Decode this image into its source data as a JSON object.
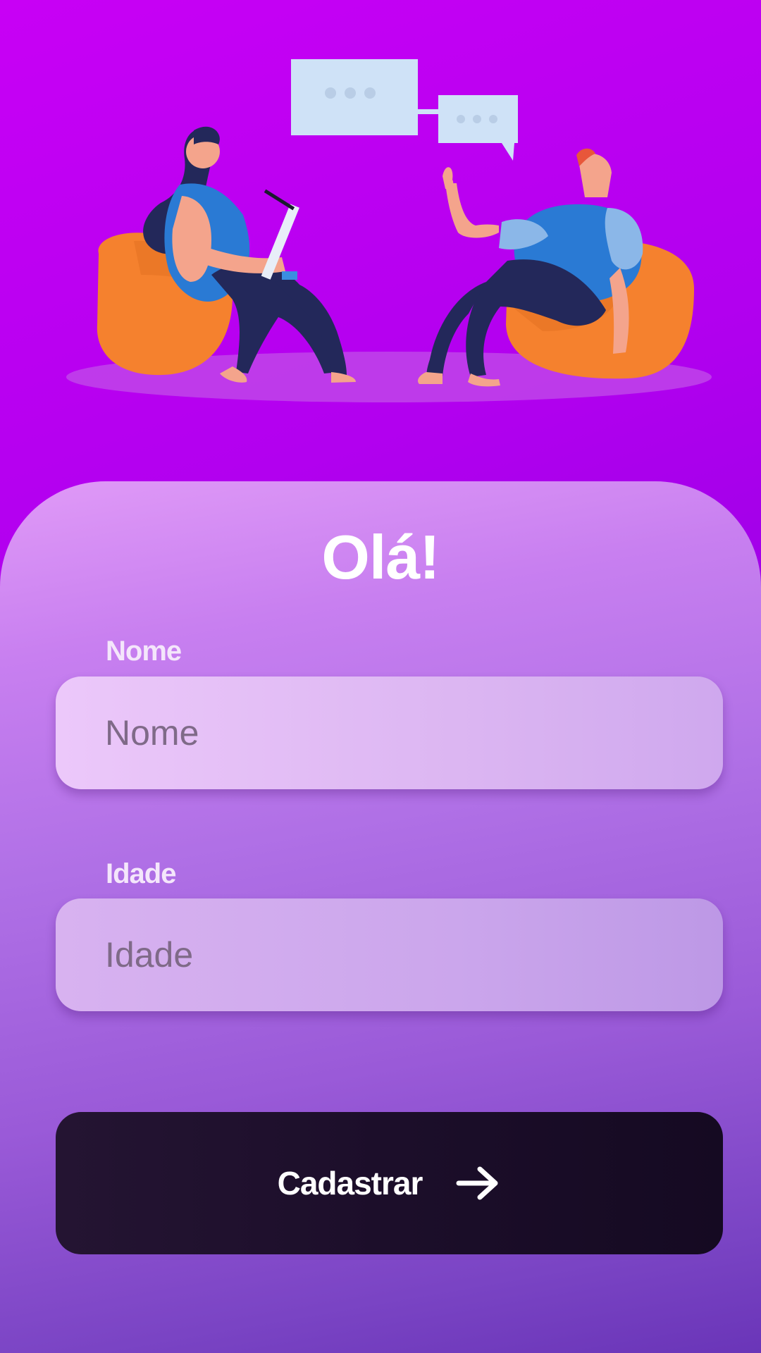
{
  "screen": {
    "background_top": "#c800f5",
    "background_bottom": "#7a00d4"
  },
  "illustration": {
    "name": "two-people-conversation-illustration",
    "colors": {
      "bean_bag": "#f5812e",
      "bubble": "#cfe2f7",
      "shirt": "#2a7ad4",
      "pants": "#23285a",
      "skin": "#f4a48c"
    }
  },
  "form": {
    "title": "Olá!",
    "fields": [
      {
        "label": "Nome",
        "placeholder": "Nome",
        "value": ""
      },
      {
        "label": "Idade",
        "placeholder": "Idade",
        "value": ""
      }
    ],
    "submit": {
      "label": "Cadastrar",
      "icon": "arrow-right-icon"
    }
  }
}
